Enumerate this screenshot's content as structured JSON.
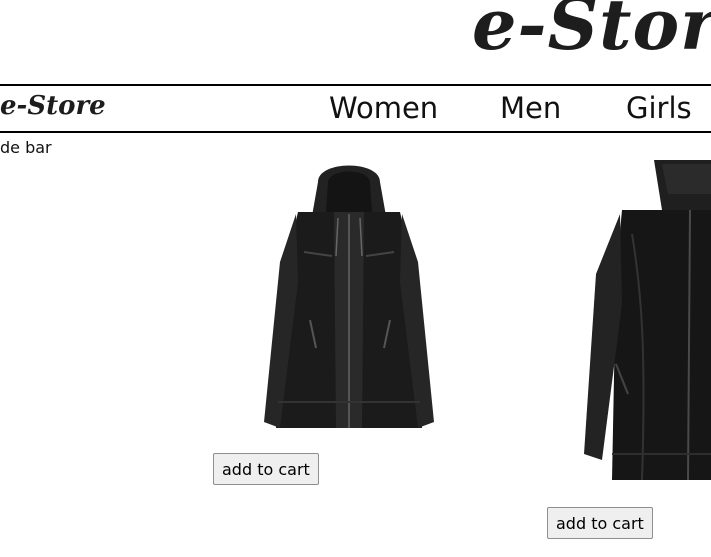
{
  "header": {
    "logo_text": "e-Store"
  },
  "nav": {
    "logo_text": "e-Store",
    "links": [
      {
        "label": "Women"
      },
      {
        "label": "Men"
      },
      {
        "label": "Girls"
      }
    ]
  },
  "sidebar": {
    "label": "de bar"
  },
  "products": [
    {
      "image": "black-hooded-leather-jacket",
      "button_label": "add to cart"
    },
    {
      "image": "black-leather-jacket",
      "button_label": "add to cart"
    }
  ],
  "colors": {
    "text": "#111111",
    "jacket": "#1a1a1a",
    "button_bg": "#efefef",
    "button_border": "#8f8f8f"
  }
}
